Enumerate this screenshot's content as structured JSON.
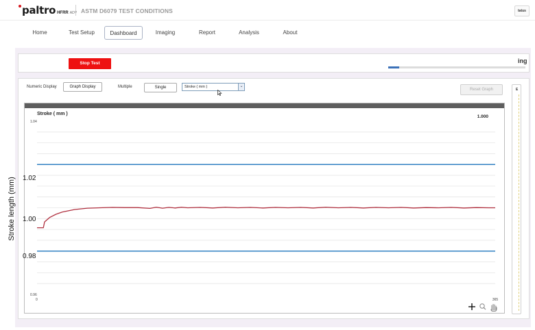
{
  "header": {
    "logo_text": "paltro",
    "logo_sub": "HFRR",
    "logo_adv": "ADV",
    "title": "ASTM D6079 TEST CONDITIONS",
    "status_label": "tatus"
  },
  "nav": {
    "tabs": [
      {
        "label": "Home"
      },
      {
        "label": "Test Setup"
      },
      {
        "label": "Dashboard"
      },
      {
        "label": "Imaging"
      },
      {
        "label": "Report"
      },
      {
        "label": "Analysis"
      },
      {
        "label": "About"
      }
    ],
    "active_tab": "Dashboard"
  },
  "run": {
    "stop_label": "Stop Test",
    "status_text": "ing",
    "progress_fraction": 0.08
  },
  "graph_controls": {
    "numeric_display_label": "Numeric Display",
    "graph_display_label": "Graph Display",
    "multiple_label": "Multiple",
    "single_label": "Single",
    "channel_value": "Stroke ( mm )",
    "reset_label": "Reset Graph"
  },
  "chart_data": {
    "type": "line",
    "title": "Stroke ( mm )",
    "ylabel": "Stroke length (mm)",
    "xlim": [
      0,
      365
    ],
    "ylim": [
      0.96,
      1.04
    ],
    "x_tick_labels": [
      "0",
      "365"
    ],
    "y_axis_printed": [
      "1.04",
      "0.96"
    ],
    "y_annotations": [
      "1.02",
      "1.00",
      "0.98"
    ],
    "current_value_label": "1.000",
    "limit_lines": [
      1.02,
      0.98
    ],
    "limit_color": "#2e7fc1",
    "series_color": "#b0303f",
    "grid": true,
    "series": [
      {
        "x": [
          0,
          5,
          6,
          10,
          15,
          20,
          30,
          40,
          50,
          60,
          70,
          80,
          90,
          95,
          100,
          105,
          110,
          115,
          120,
          130,
          140,
          150,
          160,
          170,
          180,
          190,
          200,
          210,
          220,
          230,
          240,
          250,
          260,
          270,
          280,
          290,
          300,
          310,
          320,
          330,
          340,
          350,
          360,
          365
        ],
        "y": [
          0.9908,
          0.9908,
          0.9935,
          0.9955,
          0.997,
          0.998,
          0.9992,
          0.9998,
          1.0,
          1.0002,
          1.0001,
          1.0001,
          0.9997,
          1.0003,
          0.9998,
          1.0002,
          0.9999,
          1.0003,
          1.0,
          1.0002,
          0.9999,
          1.0003,
          1.0,
          1.0002,
          0.9999,
          1.0002,
          1.0,
          1.0002,
          0.9999,
          1.0003,
          1.0,
          1.0002,
          0.9999,
          1.0002,
          1.0,
          1.0002,
          0.9999,
          1.0001,
          1.0,
          1.0002,
          0.9999,
          1.0001,
          1.0,
          1.0
        ]
      }
    ],
    "toolbar_icons": [
      "crosshair-icon",
      "zoom-icon",
      "pan-hand-icon"
    ]
  },
  "side_panel": {
    "mark": "E"
  }
}
